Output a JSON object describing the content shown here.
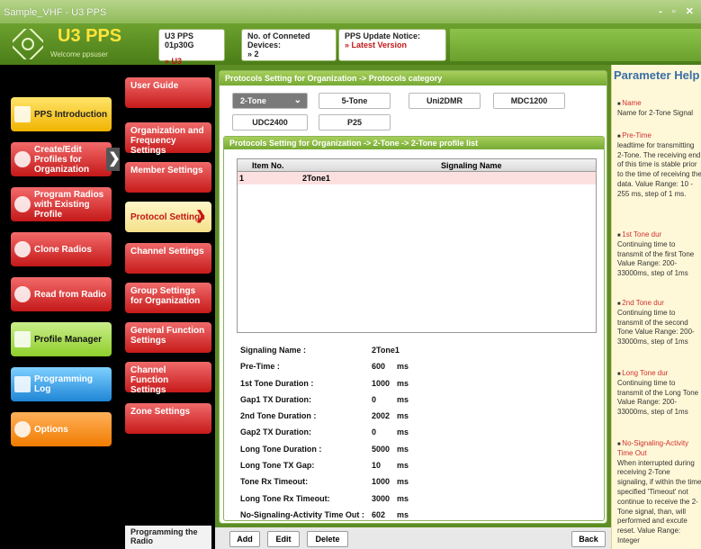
{
  "window": {
    "title": "Sample_VHF - U3 PPS",
    "controls": "- ▫ ✕"
  },
  "header": {
    "app_title": "U3 PPS",
    "welcome": "Welcome ppsuser",
    "version_label": "U3 PPS 01p30G",
    "version_path": "» U3",
    "devices_label": "No. of Conneted Devices:",
    "devices_value": "» 2",
    "update_label": "PPS Update Notice:",
    "update_value": "» Latest Version"
  },
  "left_menu": [
    {
      "label": "PPS Introduction"
    },
    {
      "label": "Create/Edit Profiles for Organization"
    },
    {
      "label": "Program Radios with Existing Profile"
    },
    {
      "label": "Clone Radios"
    },
    {
      "label": "Read from Radio"
    },
    {
      "label": "Profile Manager"
    },
    {
      "label": "Programming Log"
    },
    {
      "label": "Options"
    }
  ],
  "sub_menu": [
    {
      "label": "User Guide"
    },
    {
      "label": "Organization and Frequency Settings"
    },
    {
      "label": "Member Settings"
    },
    {
      "label": "Protocol Settings"
    },
    {
      "label": "Channel Settings"
    },
    {
      "label": "Group Settings for Organization"
    },
    {
      "label": "General Function Settings"
    },
    {
      "label": "Channel Function Settings"
    },
    {
      "label": "Zone Settings"
    }
  ],
  "sub_bottom": "Programming the Radio",
  "main": {
    "panel_title": "Protocols Setting for Organization -> Protocols category",
    "protocols": [
      "2-Tone",
      "5-Tone",
      "Uni2DMR",
      "MDC1200",
      "UDC2400",
      "P25"
    ],
    "list_title": "Protocols Setting for Organization -> 2-Tone -> 2-Tone profile list",
    "table": {
      "headers": [
        "Item No.",
        "Signaling Name"
      ],
      "rows": [
        {
          "no": "1",
          "name": "2Tone1"
        }
      ]
    },
    "details": [
      {
        "k": "Signaling Name :",
        "v": "2Tone1",
        "u": ""
      },
      {
        "k": "Pre-Time :",
        "v": "600",
        "u": "ms"
      },
      {
        "k": "1st Tone Duration :",
        "v": "1000",
        "u": "ms"
      },
      {
        "k": "Gap1 TX Duration:",
        "v": "0",
        "u": "ms"
      },
      {
        "k": "2nd Tone Duration :",
        "v": "2002",
        "u": "ms"
      },
      {
        "k": "Gap2 TX Duration:",
        "v": "0",
        "u": "ms"
      },
      {
        "k": "Long Tone Duration :",
        "v": "5000",
        "u": "ms"
      },
      {
        "k": "Long Tone TX Gap:",
        "v": "10",
        "u": "ms"
      },
      {
        "k": "Tone Rx Timeout:",
        "v": "1000",
        "u": "ms"
      },
      {
        "k": "Long Tone Rx Timeout:",
        "v": "3000",
        "u": "ms"
      },
      {
        "k": "No-Signaling-Activity Time Out :",
        "v": "602",
        "u": "ms"
      }
    ],
    "buttons": {
      "add": "Add",
      "edit": "Edit",
      "delete": "Delete",
      "back": "Back"
    }
  },
  "help": {
    "title": "Parameter Help",
    "items": [
      {
        "name": "Name",
        "desc": "Name for 2-Tone Signal"
      },
      {
        "name": "Pre-Time",
        "desc": "leadtime for transmitting 2-Tone. The receiving end of this time is stable prior to the time of receiving the data. Value Range: 10 - 255 ms, step of 1 ms."
      },
      {
        "name": "1st Tone dur",
        "desc": "Continuing time to transmit of the first Tone Value Range: 200-33000ms, step of 1ms"
      },
      {
        "name": "2nd Tone dur",
        "desc": "Continuing time to transmit of the second Tone Value Range: 200-33000ms, step of 1ms"
      },
      {
        "name": "Long Tone dur",
        "desc": "Continuing time to transmit of the Long Tone Value Range: 200-33000ms, step of 1ms"
      },
      {
        "name": "No-Signaling-Activity Time Out",
        "desc": "When interrupted during receiving 2-Tone signaling, if within the time specified 'Timeout' not continue to receive the 2-Tone signal, than, will performed and excute reset. Value Range: Integer"
      }
    ]
  },
  "colors": {
    "accent_green": "#5d8e26",
    "accent_red": "#c71a1a",
    "help_title": "#3a6ea5"
  }
}
